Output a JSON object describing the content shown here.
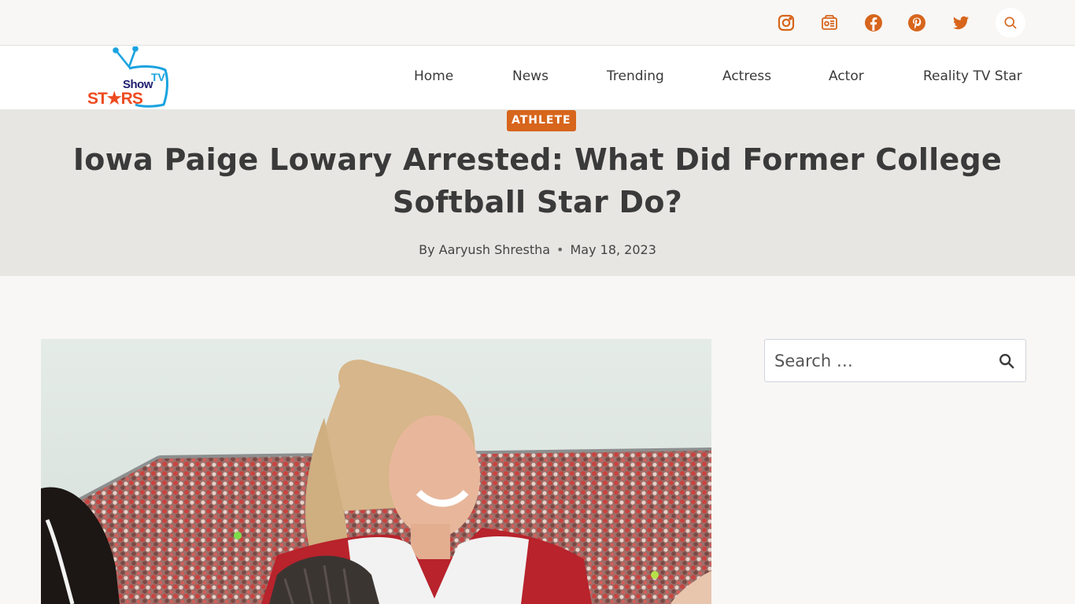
{
  "topbar": {
    "social_icons": [
      "instagram-icon",
      "google-news-icon",
      "facebook-icon",
      "pinterest-icon",
      "twitter-icon"
    ],
    "search_icon": "search-icon"
  },
  "brand": {
    "logo_show": "Show",
    "logo_tv": "TV",
    "logo_stars": "ST★RS"
  },
  "nav": {
    "items": [
      "Home",
      "News",
      "Trending",
      "Actress",
      "Actor",
      "Reality TV Star"
    ]
  },
  "post": {
    "category": "ATHLETE",
    "title": "Iowa Paige Lowary Arrested: What Did Former College Softball Star Do?",
    "author_prefix": "By ",
    "author": "Aaryush Shrestha",
    "separator": "•",
    "date": "May 18, 2023"
  },
  "sidebar": {
    "search_placeholder": "Search …"
  },
  "colors": {
    "accent": "#d7651c",
    "title_band": "#e7e6e2",
    "page_bg": "#f8f7f5",
    "jersey_red": "#b8232c"
  }
}
